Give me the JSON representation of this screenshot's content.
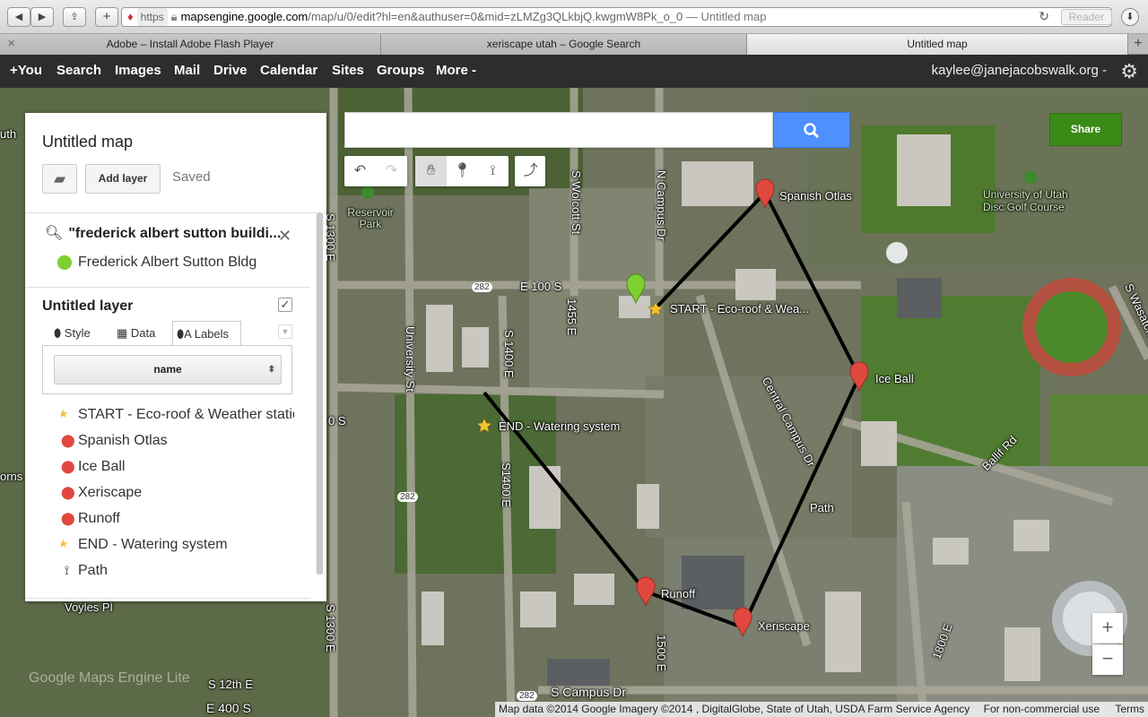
{
  "browser": {
    "url_proto": "https",
    "url_host": "mapsengine.google.com",
    "url_path": "/map/u/0/edit?hl=en&authuser=0&mid=zLMZg3QLkbjQ.kwgmW8Pk_o_0",
    "page_title_suffix": " — Untitled map",
    "reader_label": "Reader",
    "tabs": [
      {
        "title": "Adobe – Install Adobe Flash Player"
      },
      {
        "title": "xeriscape utah – Google Search"
      },
      {
        "title": "Untitled map"
      }
    ]
  },
  "gbar": {
    "items": [
      "+You",
      "Search",
      "Images",
      "Mail",
      "Drive",
      "Calendar",
      "Sites",
      "Groups",
      "More -"
    ],
    "account": "kaylee@janejacobswalk.org -"
  },
  "panel": {
    "title": "Untitled map",
    "add_layer_label": "Add layer",
    "saved_label": "Saved",
    "search_query": "\"frederick albert sutton buildi...",
    "search_result": "Frederick Albert Sutton Bldg",
    "layer_title": "Untitled layer",
    "layer_tabs": [
      "Style",
      "Data",
      "Labels"
    ],
    "label_field": "name",
    "features": [
      {
        "name": "START - Eco-roof & Weather station",
        "icon": "star"
      },
      {
        "name": "Spanish Otlas",
        "icon": "red-pin"
      },
      {
        "name": "Ice Ball",
        "icon": "red-pin"
      },
      {
        "name": "Xeriscape",
        "icon": "red-pin"
      },
      {
        "name": "Runoff",
        "icon": "red-pin"
      },
      {
        "name": "END - Watering system",
        "icon": "star"
      },
      {
        "name": "Path",
        "icon": "line"
      }
    ]
  },
  "map": {
    "share_label": "Share",
    "zoom_in": "+",
    "zoom_out": "−",
    "marker_labels": {
      "spanish_otlas": "Spanish Otlas",
      "ice_ball": "Ice Ball",
      "start": "START - Eco-roof & Wea...",
      "end": "END - Watering system",
      "runoff": "Runoff",
      "xeriscape": "Xeriscape",
      "path": "Path"
    },
    "street_labels": {
      "e100s": "E 100 S",
      "s1400e_a": "S 1400 E",
      "s1400e_b": "S1400 E",
      "s1455e": "1455 E",
      "n_campus": "N Campus Dr",
      "s_wolcott": "S Wolcott St",
      "university_st": "University St",
      "s1300e_a": "S 1300 E",
      "s1300e_b": "S 1300 E",
      "central_campus": "Central Campus Dr",
      "ballif": "Ballif Rd",
      "s_campus": "S Campus Dr",
      "e1800e": "1800 E",
      "s12th": "S 12th E",
      "e400s": "E 400 S",
      "voyles": "Voyles Pl",
      "s_wasatch": "S Wasatch",
      "r282_a": "282",
      "r282_b": "282",
      "r282_c": "282",
      "reservoir_park": "Reservoir Park",
      "u_disc_golf": "University of Utah Disc Golf Course",
      "s1500e": "1500 E",
      "edge_s": "0 S",
      "edge_orns": "orns",
      "edge_uth": "uth",
      "edge_1300e": "S 1300 E"
    },
    "attribution": "Map data ©2014 Google Imagery ©2014 , DigitalGlobe, State of Utah, USDA Farm Service Agency",
    "noncommercial": "For non-commercial use",
    "terms": "Terms",
    "watermark": "Google Maps Engine Lite"
  },
  "colors": {
    "gbar_bg": "#2d2d2d",
    "search_blue": "#4d90fe",
    "share_green": "#3a8a18",
    "pin_red": "#e0483f",
    "pin_green": "#7ed02f",
    "star": "#f2c330"
  }
}
